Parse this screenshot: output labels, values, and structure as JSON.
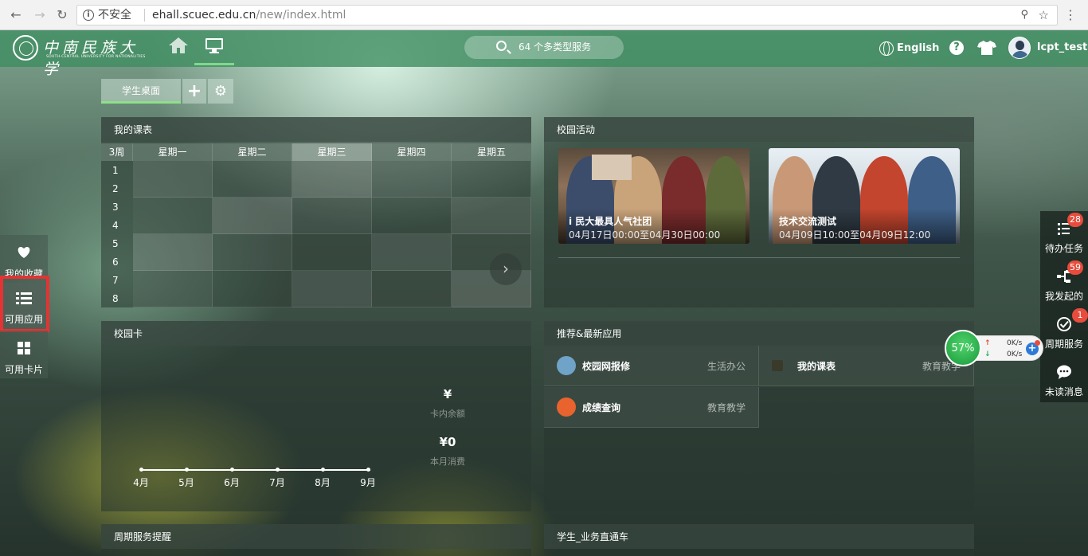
{
  "browser": {
    "insecure_label": "不安全",
    "url_host": "ehall.scuec.edu.cn",
    "url_path": "/new/index.html"
  },
  "header": {
    "logo_cn": "中南民族大学",
    "logo_en": "SOUTH-CENTRAL UNIVERSITY FOR NATIONALITIES",
    "search_label": "64 个多类型服务",
    "language": "English",
    "username": "lcpt_test"
  },
  "tabs": {
    "student_desk": "学生桌面"
  },
  "schedule": {
    "title": "我的课表",
    "week": "3周",
    "days": [
      "星期一",
      "星期二",
      "星期三",
      "星期四",
      "星期五"
    ],
    "rows": [
      "1",
      "2",
      "3",
      "4",
      "5",
      "6",
      "7",
      "8"
    ]
  },
  "activities": {
    "title": "校园活动",
    "items": [
      {
        "title": "i 民大最具人气社团",
        "date": "04月17日00:00至04月30日00:00"
      },
      {
        "title": "技术交流测试",
        "date": "04月09日10:00至04月09日12:00"
      }
    ]
  },
  "campus_card": {
    "title": "校园卡",
    "balance_value": "¥",
    "balance_label": "卡内余额",
    "monthly_value": "¥0",
    "monthly_label": "本月消费",
    "months": [
      "4月",
      "5月",
      "6月",
      "7月",
      "8月",
      "9月"
    ]
  },
  "recommend": {
    "title": "推荐&最新应用",
    "apps": [
      {
        "name": "校园网报修",
        "category": "生活办公"
      },
      {
        "name": "我的课表",
        "category": "教育教学"
      },
      {
        "name": "成绩查询",
        "category": "教育教学"
      }
    ]
  },
  "bottom_panels": {
    "left": "周期服务提醒",
    "right": "学生_业务直通车"
  },
  "left_sidebar": {
    "favorites": "我的收藏",
    "available_apps": "可用应用",
    "available_cards": "可用卡片"
  },
  "right_sidebar": {
    "todo": {
      "label": "待办任务",
      "count": "28"
    },
    "initiated": {
      "label": "我发起的",
      "count": "59"
    },
    "periodic": {
      "label": "周期服务",
      "count": "1"
    },
    "unread": {
      "label": "未读消息"
    }
  },
  "speed_widget": {
    "percent": "57%",
    "upload": "0K/s",
    "download": "0K/s"
  },
  "colors": {
    "topbar": "#3c8c5f",
    "tab_active_underline": "#8ee089",
    "badge": "#e74c3c",
    "highlight_box": "#e53333"
  }
}
